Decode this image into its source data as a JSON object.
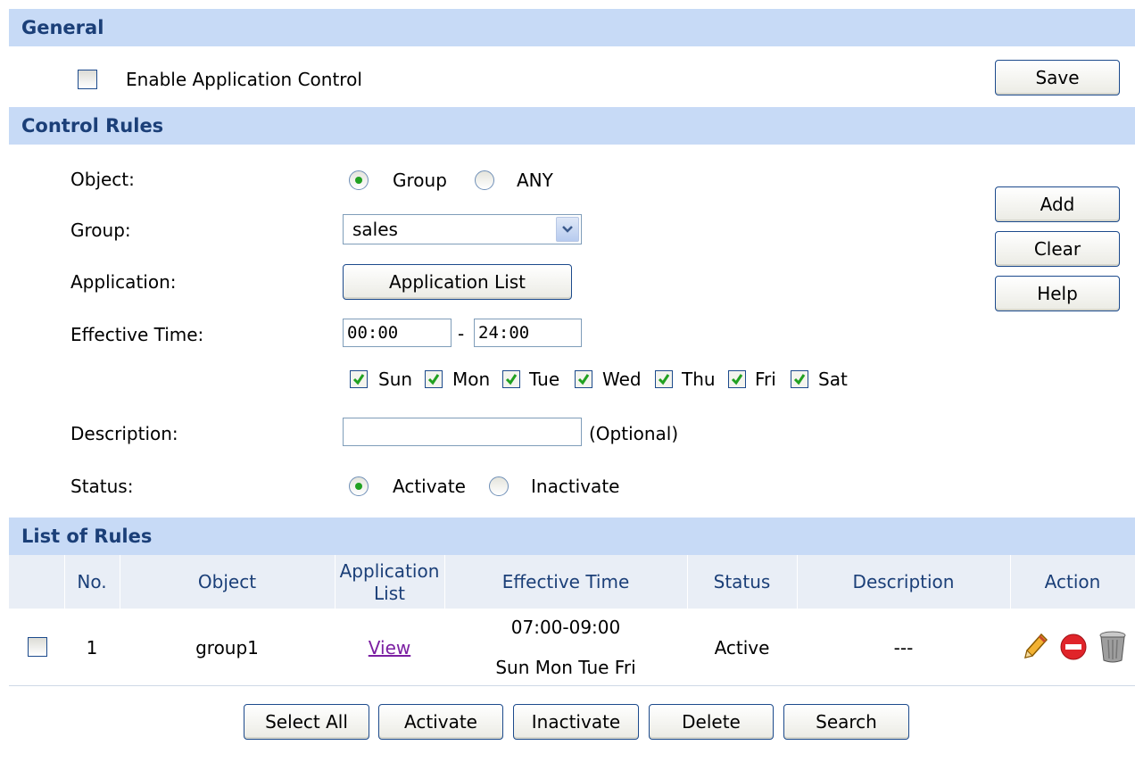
{
  "general": {
    "title": "General",
    "enable_label": "Enable Application Control",
    "save_label": "Save"
  },
  "control_rules": {
    "title": "Control Rules",
    "object_label": "Object:",
    "object_options": [
      "Group",
      "ANY"
    ],
    "object_selected": "Group",
    "group_label": "Group:",
    "group_value": "sales",
    "application_label": "Application:",
    "application_button": "Application List",
    "effective_time_label": "Effective Time:",
    "time_start": "00:00",
    "time_separator": "-",
    "time_end": "24:00",
    "days": [
      "Sun",
      "Mon",
      "Tue",
      "Wed",
      "Thu",
      "Fri",
      "Sat"
    ],
    "description_label": "Description:",
    "description_value": "",
    "description_hint": "(Optional)",
    "status_label": "Status:",
    "status_options": [
      "Activate",
      "Inactivate"
    ],
    "status_selected": "Activate",
    "add_label": "Add",
    "clear_label": "Clear",
    "help_label": "Help"
  },
  "list": {
    "title": "List of Rules",
    "columns": {
      "no": "No.",
      "object": "Object",
      "app_list_line1": "Application",
      "app_list_line2": "List",
      "time": "Effective Time",
      "status": "Status",
      "description": "Description",
      "action": "Action"
    },
    "rows": [
      {
        "no": "1",
        "object": "group1",
        "app_list": "View",
        "time_range": "07:00-09:00",
        "time_days": "Sun Mon Tue Fri",
        "status": "Active",
        "description": "---",
        "actions": [
          "edit-icon",
          "disable-icon",
          "delete-icon"
        ]
      }
    ]
  },
  "footer_buttons": {
    "select_all": "Select All",
    "activate": "Activate",
    "inactivate": "Inactivate",
    "delete": "Delete",
    "search": "Search"
  },
  "colors": {
    "section_bar": "#c7daf6",
    "section_text": "#1b3f78",
    "check_green": "#21a121",
    "link_purple": "#7b1fa2"
  }
}
